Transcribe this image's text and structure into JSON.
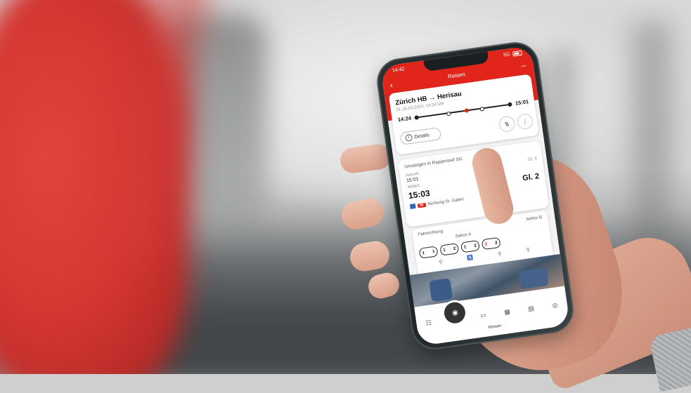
{
  "status_bar": {
    "time": "14:42",
    "signal": "5G"
  },
  "header": {
    "title": "Reisen",
    "back_icon": "chevron-left-icon",
    "logo": "⇔"
  },
  "journey": {
    "route": "Zürich HB → Herisau",
    "date": "Di, 26.03.2024, 14:24 Uhr",
    "departure": "14:24",
    "arrival": "15:01",
    "details_label": "Details"
  },
  "change": {
    "title": "Umsteigen in Rapperswil SG",
    "arrival_label": "Ankunft",
    "arrival_time": "15:01",
    "arrival_track": "Gl. 3",
    "departure_label": "Abfahrt",
    "departure_time": "15:03",
    "departure_track": "Gl. 2",
    "train": "IR",
    "direction": "Richtung St. Gallen"
  },
  "coach": {
    "direction_label": "Fahrtrichtung",
    "sector_a": "Sektor A",
    "sector_b": "Sektor B",
    "cars": [
      {
        "cls": "1",
        "num": "1"
      },
      {
        "cls": "1",
        "num": "2"
      },
      {
        "cls": "1",
        "num": "2"
      },
      {
        "cls": "2",
        "num": "2"
      }
    ]
  },
  "tabbar": {
    "active_label": "Reisen"
  },
  "colors": {
    "brand_red": "#e1251b",
    "background_red": "#d63733"
  }
}
